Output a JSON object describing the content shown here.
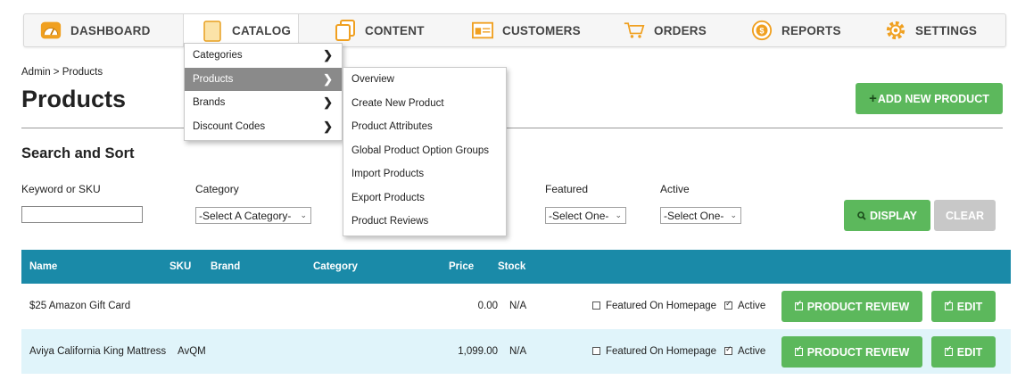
{
  "nav": {
    "items": [
      {
        "label": "DASHBOARD",
        "icon": "dashboard-icon"
      },
      {
        "label": "CATALOG",
        "icon": "catalog-icon"
      },
      {
        "label": "CONTENT",
        "icon": "content-icon"
      },
      {
        "label": "CUSTOMERS",
        "icon": "customers-icon"
      },
      {
        "label": "ORDERS",
        "icon": "orders-cart-icon"
      },
      {
        "label": "REPORTS",
        "icon": "reports-coin-icon"
      },
      {
        "label": "SETTINGS",
        "icon": "settings-gear-icon"
      }
    ],
    "active": "CATALOG"
  },
  "catalog_menu": {
    "items": [
      "Categories",
      "Products",
      "Brands",
      "Discount Codes"
    ],
    "highlighted": "Products"
  },
  "products_submenu": {
    "items": [
      "Overview",
      "Create New Product",
      "Product Attributes",
      "Global Product Option Groups",
      "Import Products",
      "Export Products",
      "Product Reviews"
    ]
  },
  "breadcrumb": "Admin > Products",
  "page_title": "Products",
  "add_button": "ADD NEW PRODUCT",
  "search": {
    "title": "Search and Sort",
    "keyword_label": "Keyword or SKU",
    "keyword_value": "",
    "category_label": "Category",
    "category_value": "-Select A Category-",
    "featured_label": "Featured",
    "featured_value": "-Select One-",
    "active_label": "Active",
    "active_value": "-Select One-",
    "display_button": "DISPLAY",
    "clear_button": "CLEAR"
  },
  "table": {
    "headers": {
      "name": "Name",
      "sku": "SKU",
      "brand": "Brand",
      "category": "Category",
      "price": "Price",
      "stock": "Stock"
    },
    "rows": [
      {
        "name": "$25 Amazon Gift Card",
        "sku": "",
        "price": "0.00",
        "stock": "N/A",
        "featured_label": "Featured On Homepage",
        "featured": false,
        "active_label": "Active",
        "active": true,
        "review_button": "PRODUCT REVIEW",
        "edit_button": "EDIT"
      },
      {
        "name": "Aviya California King Mattress",
        "sku": "AvQM",
        "price": "1,099.00",
        "stock": "N/A",
        "featured_label": "Featured On Homepage",
        "featured": false,
        "active_label": "Active",
        "active": true,
        "review_button": "PRODUCT REVIEW",
        "edit_button": "EDIT"
      }
    ]
  },
  "colors": {
    "accent_green": "#5cb85c",
    "table_header": "#1a8aa8",
    "row_alt": "#e0f4fa",
    "icon_orange": "#f0a020"
  }
}
